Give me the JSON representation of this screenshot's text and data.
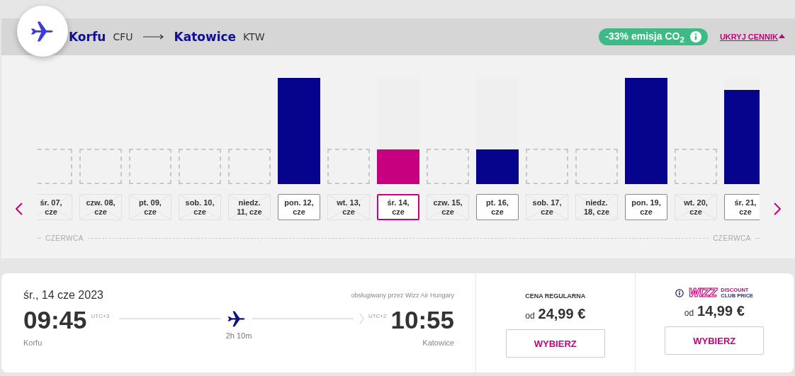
{
  "route": {
    "origin": {
      "city": "Korfu",
      "code": "CFU"
    },
    "destination": {
      "city": "Katowice",
      "code": "KTW"
    }
  },
  "emission_badge": "-33% emisja CO$_{2}$",
  "hide_prices_link": "UKRYJ CENNIK",
  "days": [
    {
      "lines": [
        "śr. 07,",
        "cze"
      ],
      "available": false,
      "selected": false
    },
    {
      "lines": [
        "czw. 08,",
        "cze"
      ],
      "available": false,
      "selected": false
    },
    {
      "lines": [
        "pt. 09,",
        "cze"
      ],
      "available": false,
      "selected": false
    },
    {
      "lines": [
        "sob. 10,",
        "cze"
      ],
      "available": false,
      "selected": false
    },
    {
      "lines": [
        "niedz.",
        "11, cze"
      ],
      "available": false,
      "selected": false
    },
    {
      "lines": [
        "pon. 12,",
        "cze"
      ],
      "available": true,
      "selected": false,
      "level": 1
    },
    {
      "lines": [
        "wt. 13,",
        "cze"
      ],
      "available": false,
      "selected": false
    },
    {
      "lines": [
        "śr. 14,",
        "cze"
      ],
      "available": true,
      "selected": true,
      "level": 0.33
    },
    {
      "lines": [
        "czw. 15,",
        "cze"
      ],
      "available": false,
      "selected": false
    },
    {
      "lines": [
        "pt. 16,",
        "cze"
      ],
      "available": true,
      "selected": false,
      "level": 0.33
    },
    {
      "lines": [
        "sob. 17,",
        "cze"
      ],
      "available": false,
      "selected": false
    },
    {
      "lines": [
        "niedz.",
        "18, cze"
      ],
      "available": false,
      "selected": false
    },
    {
      "lines": [
        "pon. 19,",
        "cze"
      ],
      "available": true,
      "selected": false,
      "level": 1
    },
    {
      "lines": [
        "wt. 20,",
        "cze"
      ],
      "available": false,
      "selected": false
    },
    {
      "lines": [
        "śr. 21,",
        "cze"
      ],
      "available": true,
      "selected": false,
      "level": 0.89
    }
  ],
  "month_labels": [
    "CZERWCA",
    "CZERWCA"
  ],
  "flight": {
    "date": "śr., 14 cze 2023",
    "operator": "obsługiwany przez Wizz Air Hungary",
    "departure_time": "09:45",
    "departure_tz": "UTC+3",
    "arrival_time": "10:55",
    "arrival_tz": "UTC+2",
    "duration": "2h 10m",
    "origin": "Korfu",
    "destination": "Katowice"
  },
  "fares": [
    {
      "kind": "regular",
      "title": "CENA REGULARNA",
      "prefix": "od",
      "price": "24,99 €",
      "button": "WYBIERZ"
    },
    {
      "kind": "club",
      "logo_word": "WIZZ",
      "logo_lines": [
        "DISCOUNT",
        "CLUB PRICE"
      ],
      "prefix": "od",
      "price": "14,99 €",
      "button": "WYBIERZ"
    }
  ]
}
